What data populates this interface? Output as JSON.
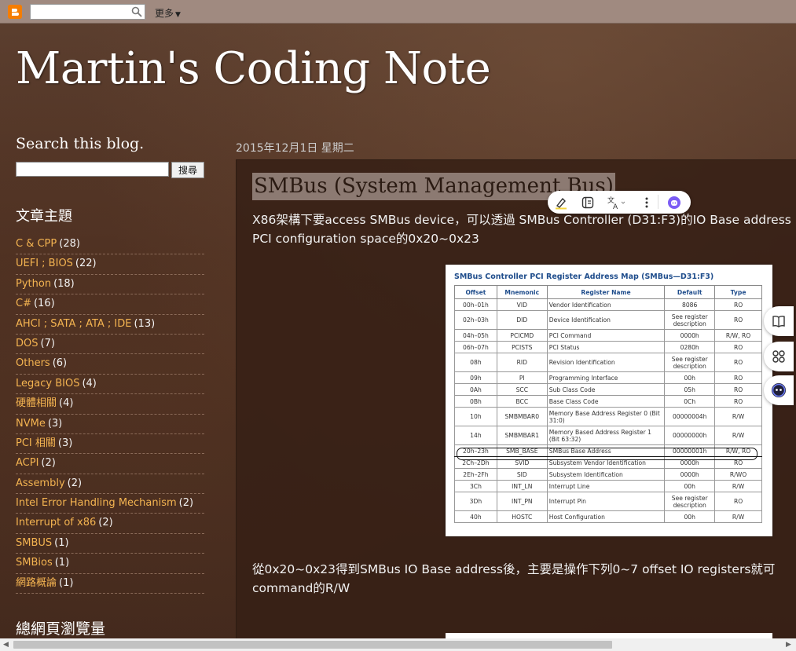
{
  "navbar": {
    "more_label": "更多",
    "search_value": "",
    "logo_icon": "blogger-icon",
    "search_icon": "magnifier-icon",
    "more_icon": "caret-down-icon"
  },
  "header": {
    "title": "Martin's Coding Note"
  },
  "sidebar": {
    "search_heading": "Search this blog.",
    "search_value": "",
    "search_button": "搜尋",
    "labels_heading": "文章主題",
    "labels": [
      {
        "name": "C & CPP",
        "count": "(28)"
      },
      {
        "name": "UEFI ; BIOS",
        "count": "(22)"
      },
      {
        "name": "Python",
        "count": "(18)"
      },
      {
        "name": "C#",
        "count": "(16)"
      },
      {
        "name": "AHCI ; SATA ; ATA ; IDE",
        "count": "(13)"
      },
      {
        "name": "DOS",
        "count": "(7)"
      },
      {
        "name": "Others",
        "count": "(6)"
      },
      {
        "name": "Legacy BIOS",
        "count": "(4)"
      },
      {
        "name": "硬體相關",
        "count": "(4)"
      },
      {
        "name": "NVMe",
        "count": "(3)"
      },
      {
        "name": "PCI 相關",
        "count": "(3)"
      },
      {
        "name": "ACPI",
        "count": "(2)"
      },
      {
        "name": "Assembly",
        "count": "(2)"
      },
      {
        "name": "Intel Error Handling Mechanism",
        "count": "(2)"
      },
      {
        "name": "Interrupt of x86",
        "count": "(2)"
      },
      {
        "name": "SMBUS",
        "count": "(1)"
      },
      {
        "name": "SMBios",
        "count": "(1)"
      },
      {
        "name": "網路概論",
        "count": "(1)"
      }
    ],
    "views_heading": "總網頁瀏覽量"
  },
  "post": {
    "date": "2015年12月1日 星期二",
    "title": "SMBus (System Management Bus)",
    "para1_line1": "X86架構下要access SMBus device，可以透過 SMBus Controller (D31:F3)的IO Base address",
    "para1_line2": "PCI configuration space的0x20~0x23",
    "para2_line1": "從0x20~0x23得到SMBus IO Base address後，主要是操作下列0~7 offset IO registers就可",
    "para2_line2": "command的R/W"
  },
  "register_map": {
    "caption": "SMBus Controller PCI Register Address Map (SMBus—D31:F3)",
    "headers": [
      "Offset",
      "Mnemonic",
      "Register Name",
      "Default",
      "Type"
    ],
    "rows": [
      [
        "00h–01h",
        "VID",
        "Vendor Identification",
        "8086",
        "RO"
      ],
      [
        "02h–03h",
        "DID",
        "Device Identification",
        "See register description",
        "RO"
      ],
      [
        "04h–05h",
        "PCICMD",
        "PCI Command",
        "0000h",
        "R/W, RO"
      ],
      [
        "06h–07h",
        "PCISTS",
        "PCI Status",
        "0280h",
        "RO"
      ],
      [
        "08h",
        "RID",
        "Revision Identification",
        "See register description",
        "RO"
      ],
      [
        "09h",
        "PI",
        "Programming Interface",
        "00h",
        "RO"
      ],
      [
        "0Ah",
        "SCC",
        "Sub Class Code",
        "05h",
        "RO"
      ],
      [
        "0Bh",
        "BCC",
        "Base Class Code",
        "0Ch",
        "RO"
      ],
      [
        "10h",
        "SMBMBAR0",
        "Memory Base Address Register 0 (Bit 31:0)",
        "00000004h",
        "R/W"
      ],
      [
        "14h",
        "SMBMBAR1",
        "Memory Based Address Register 1 (Bit 63:32)",
        "00000000h",
        "R/W"
      ],
      [
        "20h–23h",
        "SMB_BASE",
        "SMBus Base Address",
        "00000001h",
        "R/W, RO"
      ],
      [
        "2Ch–2Dh",
        "SVID",
        "Subsystem Vendor Identification",
        "0000h",
        "RO"
      ],
      [
        "2Eh–2Fh",
        "SID",
        "Subsystem Identification",
        "0000h",
        "R/WO"
      ],
      [
        "3Ch",
        "INT_LN",
        "Interrupt Line",
        "00h",
        "R/W"
      ],
      [
        "3Dh",
        "INT_PN",
        "Interrupt Pin",
        "See register description",
        "RO"
      ],
      [
        "40h",
        "HOSTC",
        "Host Configuration",
        "00h",
        "R/W"
      ]
    ],
    "highlighted_row": 10
  },
  "toolbar_icons": [
    "highlighter-icon",
    "note-icon",
    "translate-icon",
    "more-vert-icon",
    "assistant-icon"
  ],
  "side_actions": [
    "reader-icon",
    "apps-icon",
    "assistant-face-icon"
  ]
}
